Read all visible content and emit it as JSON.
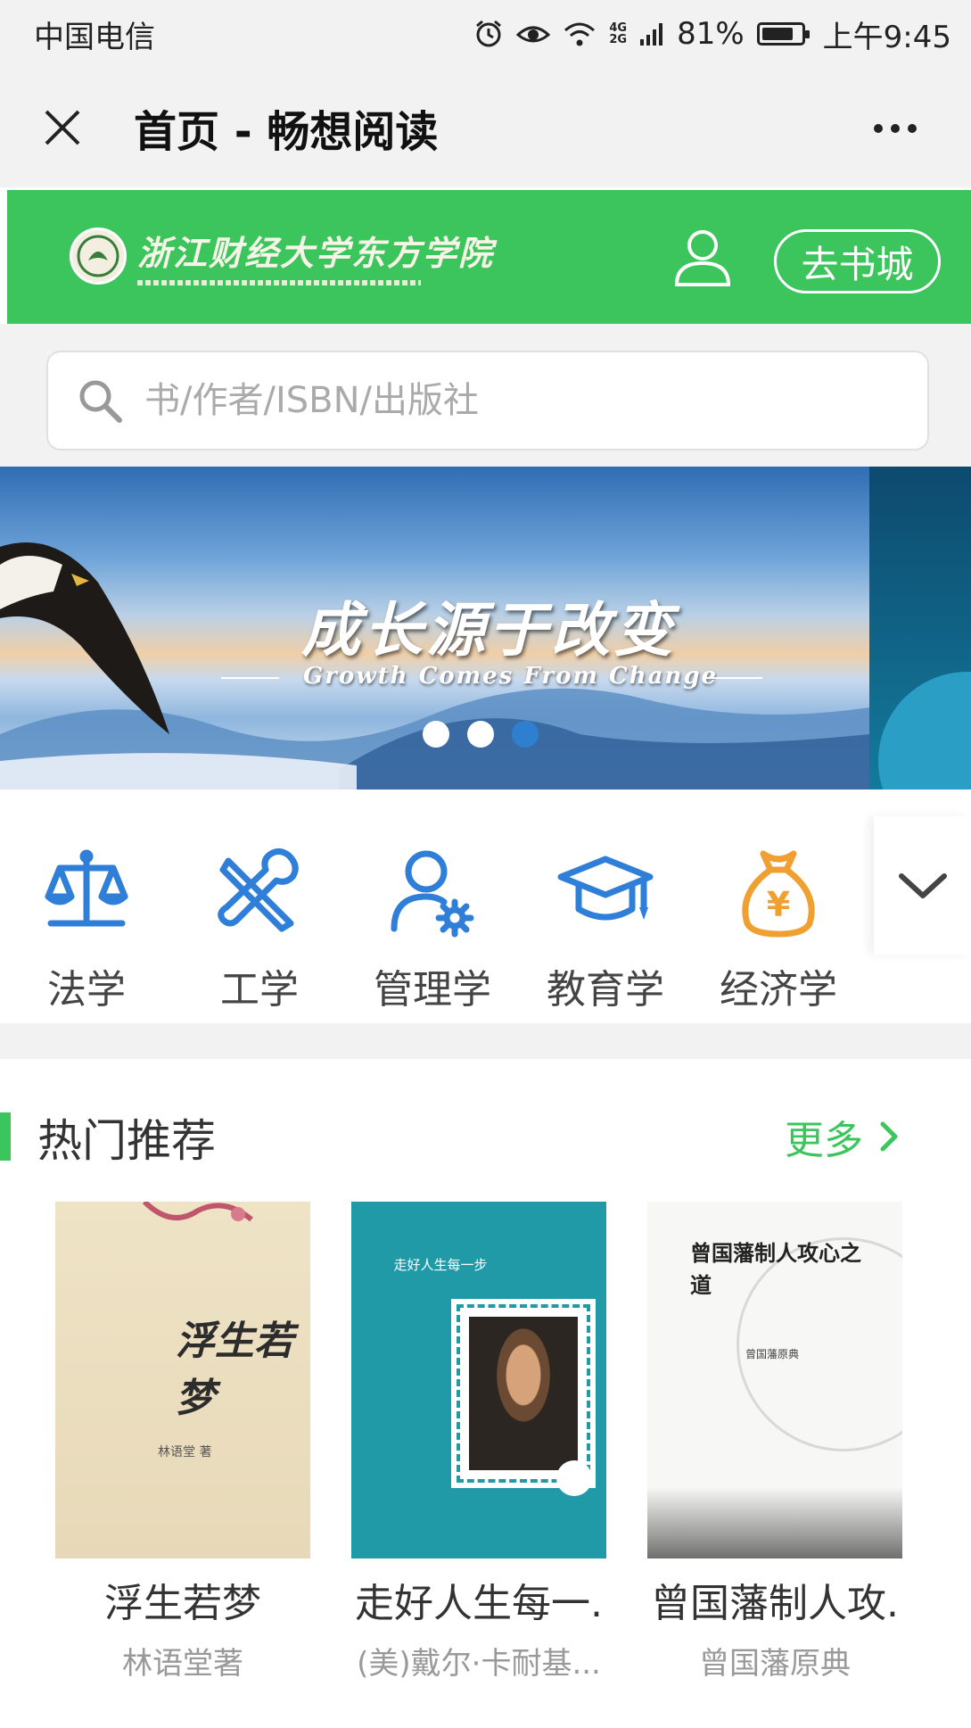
{
  "status_bar": {
    "carrier": "中国电信",
    "network": [
      "4G",
      "2G"
    ],
    "battery_percent": "81%",
    "battery_level": 0.81,
    "time": "上午9:45",
    "icons": [
      "alarm-icon",
      "eye-icon",
      "wifi-icon",
      "signal-icon",
      "battery-icon"
    ]
  },
  "nav": {
    "title": "首页 - 畅想阅读"
  },
  "header": {
    "logo_name": "浙江财经大学东方学院",
    "store_button": "去书城",
    "accent_color": "#3cc55c"
  },
  "search": {
    "placeholder": "书/作者/ISBN/出版社",
    "value": ""
  },
  "banner": {
    "title": "成长源于改变",
    "subtitle": "Growth Comes From Change",
    "slide_count": 3,
    "active_slide": 3
  },
  "categories": [
    {
      "label": "法学",
      "icon": "scales-icon"
    },
    {
      "label": "工学",
      "icon": "tools-icon"
    },
    {
      "label": "管理学",
      "icon": "user-gear-icon"
    },
    {
      "label": "教育学",
      "icon": "graduation-cap-icon"
    },
    {
      "label": "经济学",
      "icon": "money-bag-icon"
    }
  ],
  "hot": {
    "title": "热门推荐",
    "more": "更多"
  },
  "books": [
    {
      "title": "浮生若梦",
      "author": "林语堂著",
      "cover_title": "浮生若梦",
      "cover_author": "林语堂 著"
    },
    {
      "title": "走好人生每一.",
      "author": "(美)戴尔·卡耐基...",
      "cover_title": "走好人生每一步"
    },
    {
      "title": "曾国藩制人攻.",
      "author": "曾国藩原典",
      "cover_title": "曾国藩制人攻心之道",
      "cover_subtitle": "曾国藩原典"
    }
  ]
}
